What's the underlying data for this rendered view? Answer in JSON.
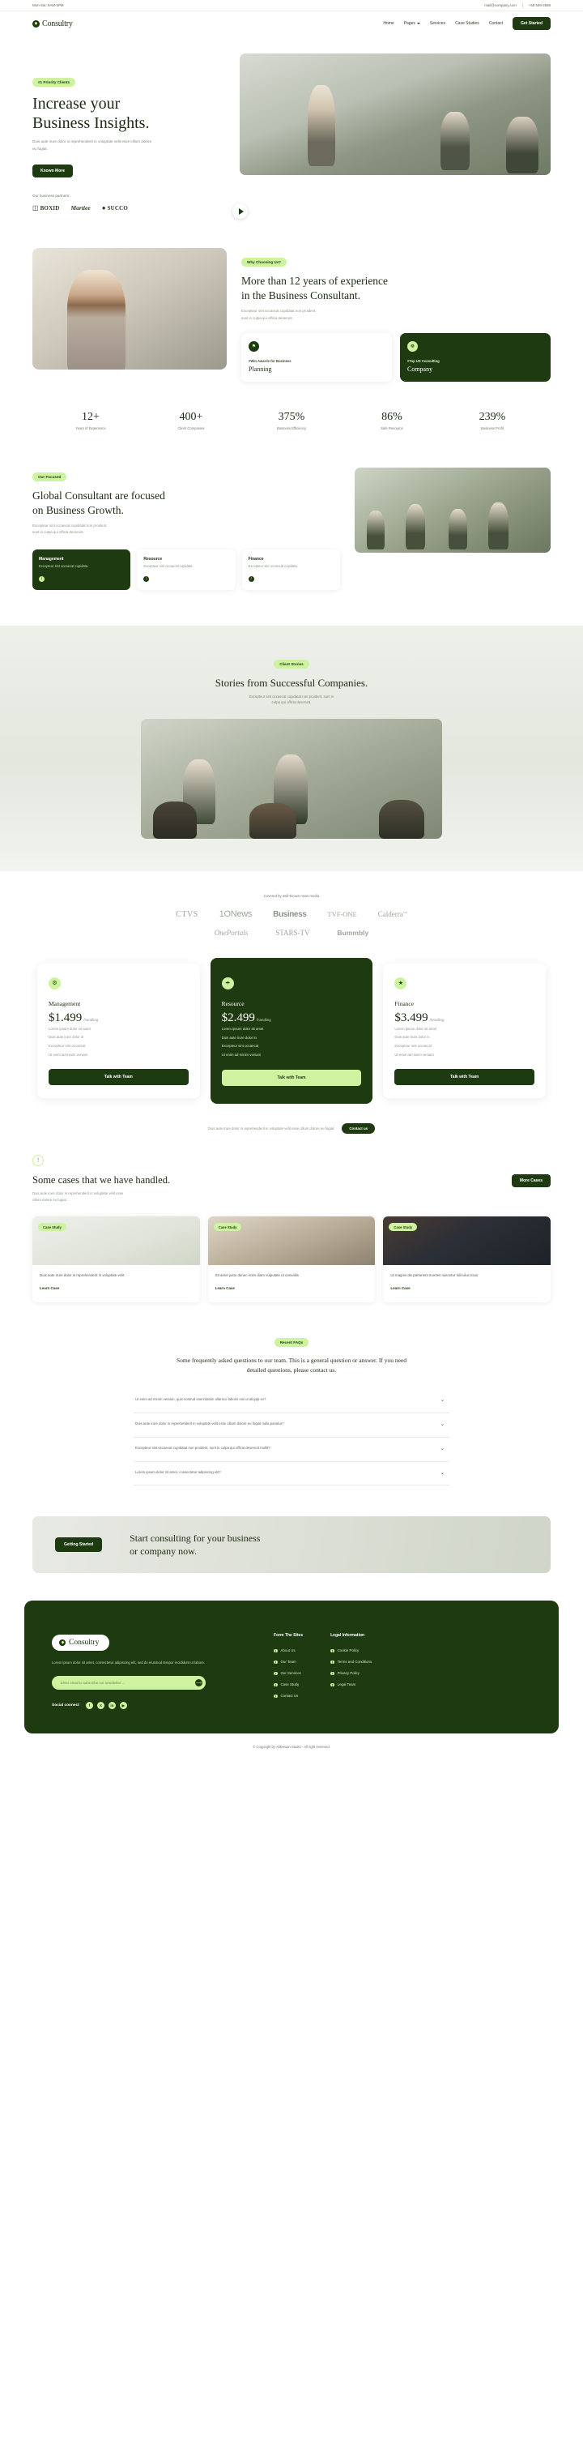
{
  "topbar": {
    "hours": "Mon-Sat: 9AM-5PM",
    "email": "mail@company.com",
    "phone": "+58 569-2558"
  },
  "nav": {
    "brand": "Consultry",
    "links": [
      {
        "label": "Home",
        "has_caret": false
      },
      {
        "label": "Pages",
        "has_caret": true
      },
      {
        "label": "Services",
        "has_caret": false
      },
      {
        "label": "Case Studies",
        "has_caret": false
      },
      {
        "label": "Contact",
        "has_caret": false
      }
    ],
    "cta": "Get Started"
  },
  "hero": {
    "badge": "#1 Priority Clients",
    "title_line1": "Increase your",
    "title_line2": "Business Insights.",
    "subtitle": "Duis aute irure dolor in reprehenderit in voluptate velit esse cillum dolore eu fugiat.",
    "button": "Known More",
    "partners_label": "Our business partners:",
    "partners": [
      {
        "name": "BOXID",
        "style": "box"
      },
      {
        "name": "Martiee",
        "style": "script"
      },
      {
        "name": "SUCCO",
        "style": "round"
      }
    ]
  },
  "why": {
    "badge": "Why Choosing Us?",
    "title_line1": "More than 12 years of experience",
    "title_line2": "in the Business Consultant.",
    "subtitle_line1": "Excepteur sint occaecat cupidatat non proident,",
    "subtitle_line2": "sunt in culpa qui officia deserunt.",
    "cards": [
      {
        "icon": "award-icon",
        "tag": "#Win Awards for Business",
        "title": "Planning",
        "dark": false
      },
      {
        "icon": "people-icon",
        "tag": "#Top US Consulting",
        "title": "Company",
        "dark": true
      }
    ]
  },
  "stats": [
    {
      "value": "12+",
      "label": "Years of Experience"
    },
    {
      "value": "400+",
      "label": "Client Companies"
    },
    {
      "value": "375%",
      "label": "Business Efficiency"
    },
    {
      "value": "86%",
      "label": "Safe Resource"
    },
    {
      "value": "239%",
      "label": "Business Profit"
    }
  ],
  "focused": {
    "badge": "Our Focused",
    "title_line1": "Global Consultant are focused",
    "title_line2": "on Business Growth.",
    "subtitle_line1": "Excepteur sint occaecat cupidatat non proident,",
    "subtitle_line2": "sunt in culpa qui officia deserunt.",
    "cards": [
      {
        "title": "Management",
        "desc": "Excepteur sint occaecat cupidata.",
        "dark": true
      },
      {
        "title": "Resource",
        "desc": "Excepteur sint occaecat cupidata.",
        "dark": false
      },
      {
        "title": "Finance",
        "desc": "Excepteur sint occaecat cupidata.",
        "dark": false
      }
    ]
  },
  "stories": {
    "badge": "Client Stories",
    "title": "Stories from Successful Companies.",
    "subtitle_line1": "Excepteur sint occaecat cupidatat non proident, sunt in",
    "subtitle_line2": "culpa qui officia deserunt."
  },
  "media": {
    "caption": "Covered by well-known news media",
    "row1": [
      "CTVS",
      "1ONews",
      "Business",
      "TVF-ONE",
      "Calderra"
    ],
    "row2": [
      "OnePortals",
      "STARS-TV",
      "Bummbly"
    ]
  },
  "pricing": [
    {
      "icon": "management-icon",
      "name": "Management",
      "price": "$1.499",
      "period": "/handling",
      "features": [
        "Lorem ipsum dolor sit amet",
        "Duis aute irure dolor in",
        "Excepteur sint occaecat",
        "Ut enim ad minim veniam"
      ],
      "button": "Talk with Team",
      "featured": false
    },
    {
      "icon": "resource-icon",
      "name": "Resource",
      "price": "$2.499",
      "period": "/handling",
      "features": [
        "Lorem ipsum dolor sit amet",
        "Duis aute irure dolor in",
        "Excepteur sint occaecat",
        "Ut enim ad minim veniam"
      ],
      "button": "Talk with Team",
      "featured": true
    },
    {
      "icon": "finance-icon",
      "name": "Finance",
      "price": "$3.499",
      "period": "/handling",
      "features": [
        "Lorem ipsum dolor sit amet",
        "Duis aute irure dolor in",
        "Excepteur sint occaecat",
        "Ut enim ad minim veniam"
      ],
      "button": "Talk with Team",
      "featured": false
    }
  ],
  "cta_strip": {
    "text": "Duis aute irure dolor in reprehenderit in voluptate velit esse cillum dolore eu fugiat.",
    "button": "Contact us"
  },
  "cases": {
    "title": "Some cases that we have handled.",
    "subtitle_line1": "Duis aute irure dolor in reprehenderit in voluptate velit esse",
    "subtitle_line2": "cillum dolore eu fugiat.",
    "button": "More Cases",
    "items": [
      {
        "tag": "Case Study",
        "text": "Duis aute irure dolor in reprehenderit in voluptate velit",
        "link": "Learn Case"
      },
      {
        "tag": "Case Study",
        "text": "Sit amet justo donec enim diam vulputate ut convallis",
        "link": "Learn Case"
      },
      {
        "tag": "Case Study",
        "text": "Ut magnis dis parturient montes nascetur ridiculus risus",
        "link": "Learn Case"
      }
    ]
  },
  "faq": {
    "badge": "Recent FAQs",
    "heading": "Some frequently asked questions to our team. This is a general question or answer. If you need detailed questions, please contact us.",
    "items": [
      "Ut enim ad minim veniam, quis nostrud exercitation ullamco laboris nisi ut aliquip ex?",
      "Duis aute irure dolor in reprehenderit in voluptate velit esse cillum dolore eu fugiat nulla pariatur?",
      "Excepteur sint occaecat cupidatat non proident, sunt in culpa qui officia deserunt mollit?",
      "Lorem ipsum dolor sit amet, consectetur adipiscing elit?"
    ]
  },
  "consult": {
    "button": "Getting Started",
    "title_line1": "Start consulting for your business",
    "title_line2": "or company now."
  },
  "footer": {
    "brand": "Consultry",
    "description": "Lorem ipsum dolor sit amet, consectetur adipiscing elit, sed do eiusmod tempor incididunt ut labore.",
    "newsletter_placeholder": "Enter email to subscribe our newsletter ...",
    "social_label": "Social connect",
    "socials": [
      "facebook-icon",
      "x-icon",
      "linkedin-icon",
      "youtube-icon"
    ],
    "columns": [
      {
        "heading": "Form The Sites",
        "links": [
          "About Us",
          "Our Team",
          "Our Services",
          "Case Study",
          "Contact Us"
        ]
      },
      {
        "heading": "Legal Information",
        "links": [
          "Cookie Policy",
          "Terms and Conditions",
          "Privacy Policy",
          "Legal Team"
        ]
      }
    ],
    "copyright": "© Copyright by AltDesain Studio - All right reserved."
  },
  "colors": {
    "dark_green": "#1e3a10",
    "light_green": "#cdf3a0",
    "text_muted": "#8d978e"
  }
}
